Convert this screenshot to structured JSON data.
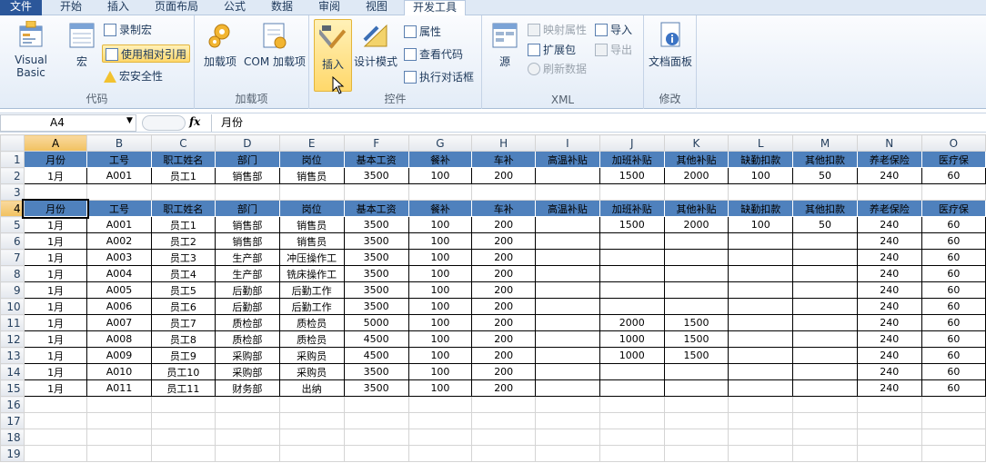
{
  "ribbon_tabs": [
    "文件",
    "开始",
    "插入",
    "页面布局",
    "公式",
    "数据",
    "审阅",
    "视图",
    "开发工具"
  ],
  "groups": {
    "code": {
      "label": "代码",
      "vb": "Visual Basic",
      "macro": "宏",
      "record": "录制宏",
      "relative": "使用相对引用",
      "security": "宏安全性"
    },
    "addins": {
      "label": "加载项",
      "addin": "加载项",
      "com": "COM 加载项"
    },
    "controls": {
      "label": "控件",
      "insert": "插入",
      "design": "设计模式",
      "props": "属性",
      "viewcode": "查看代码",
      "dialog": "执行对话框"
    },
    "xml": {
      "label": "XML",
      "source": "源",
      "map": "映射属性",
      "expand": "扩展包",
      "refresh": "刷新数据",
      "import": "导入",
      "export": "导出"
    },
    "modify": {
      "label": "修改",
      "docpanel": "文档面板"
    }
  },
  "name_box": "A4",
  "fx_label": "fx",
  "formula_value": "月份",
  "columns": [
    "A",
    "B",
    "C",
    "D",
    "E",
    "F",
    "G",
    "H",
    "I",
    "J",
    "K",
    "L",
    "M",
    "N",
    "O"
  ],
  "header_row": [
    "月份",
    "工号",
    "职工姓名",
    "部门",
    "岗位",
    "基本工资",
    "餐补",
    "车补",
    "高温补贴",
    "加班补贴",
    "其他补贴",
    "缺勤扣款",
    "其他扣款",
    "养老保险",
    "医疗保"
  ],
  "row2": [
    "1月",
    "A001",
    "员工1",
    "销售部",
    "销售员",
    "3500",
    "100",
    "200",
    "",
    "1500",
    "2000",
    "100",
    "50",
    "240",
    "60"
  ],
  "employees": [
    [
      "1月",
      "A001",
      "员工1",
      "销售部",
      "销售员",
      "3500",
      "100",
      "200",
      "",
      "1500",
      "2000",
      "100",
      "50",
      "240",
      "60"
    ],
    [
      "1月",
      "A002",
      "员工2",
      "销售部",
      "销售员",
      "3500",
      "100",
      "200",
      "",
      "",
      "",
      "",
      "",
      "240",
      "60"
    ],
    [
      "1月",
      "A003",
      "员工3",
      "生产部",
      "冲压操作工",
      "3500",
      "100",
      "200",
      "",
      "",
      "",
      "",
      "",
      "240",
      "60"
    ],
    [
      "1月",
      "A004",
      "员工4",
      "生产部",
      "铣床操作工",
      "3500",
      "100",
      "200",
      "",
      "",
      "",
      "",
      "",
      "240",
      "60"
    ],
    [
      "1月",
      "A005",
      "员工5",
      "后勤部",
      "后勤工作",
      "3500",
      "100",
      "200",
      "",
      "",
      "",
      "",
      "",
      "240",
      "60"
    ],
    [
      "1月",
      "A006",
      "员工6",
      "后勤部",
      "后勤工作",
      "3500",
      "100",
      "200",
      "",
      "",
      "",
      "",
      "",
      "240",
      "60"
    ],
    [
      "1月",
      "A007",
      "员工7",
      "质检部",
      "质检员",
      "5000",
      "100",
      "200",
      "",
      "2000",
      "1500",
      "",
      "",
      "240",
      "60"
    ],
    [
      "1月",
      "A008",
      "员工8",
      "质检部",
      "质检员",
      "4500",
      "100",
      "200",
      "",
      "1000",
      "1500",
      "",
      "",
      "240",
      "60"
    ],
    [
      "1月",
      "A009",
      "员工9",
      "采购部",
      "采购员",
      "4500",
      "100",
      "200",
      "",
      "1000",
      "1500",
      "",
      "",
      "240",
      "60"
    ],
    [
      "1月",
      "A010",
      "员工10",
      "采购部",
      "采购员",
      "3500",
      "100",
      "200",
      "",
      "",
      "",
      "",
      "",
      "240",
      "60"
    ],
    [
      "1月",
      "A011",
      "员工11",
      "财务部",
      "出纳",
      "3500",
      "100",
      "200",
      "",
      "",
      "",
      "",
      "",
      "240",
      "60"
    ]
  ],
  "row_numbers": [
    "1",
    "2",
    "3",
    "4",
    "5",
    "6",
    "7",
    "8",
    "9",
    "10",
    "11",
    "12",
    "13",
    "14",
    "15",
    "16",
    "17",
    "18",
    "19"
  ],
  "colors": {
    "header_fill": "#4f81bd",
    "selected_header": "#f1c15f",
    "file_tab": "#2b579a"
  }
}
